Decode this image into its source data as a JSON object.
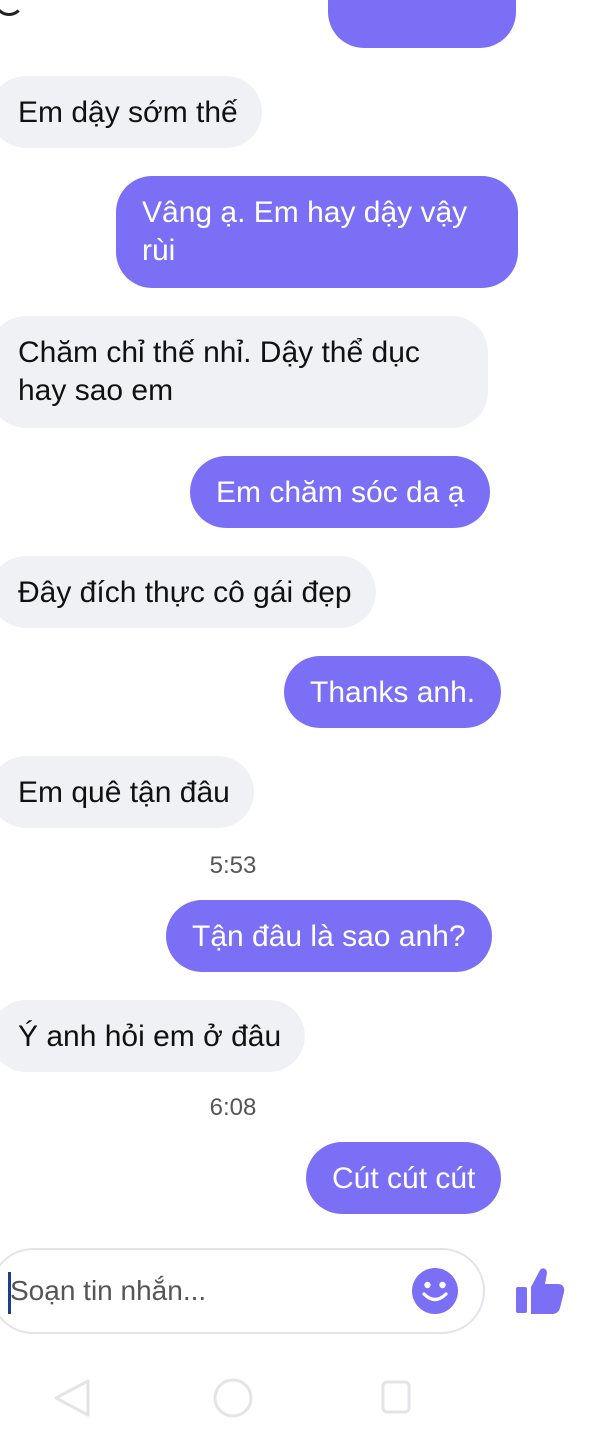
{
  "conversation": {
    "messages": [
      {
        "side": "in",
        "text": "Em dậy sớm thế"
      },
      {
        "side": "out",
        "text": "Vâng ạ. Em hay dậy vậy rùi"
      },
      {
        "side": "in",
        "text": "Chăm chỉ thế nhỉ. Dậy thể dục hay sao em"
      },
      {
        "side": "out",
        "text": "Em chăm sóc da ạ"
      },
      {
        "side": "in",
        "text": "Đây đích thực cô gái đẹp"
      },
      {
        "side": "out",
        "text": "Thanks anh."
      },
      {
        "side": "in",
        "text": "Em quê tận đâu"
      },
      {
        "side": "out",
        "text": "Tận đâu là sao anh?"
      },
      {
        "side": "in",
        "text": "Ý anh hỏi em ở đâu"
      },
      {
        "side": "out",
        "text": "Cút cút cút"
      }
    ],
    "timestamps": [
      "5:53",
      "6:08"
    ]
  },
  "composer": {
    "placeholder": "Soạn tin nhắn...",
    "value": "",
    "emoji_icon": "smiley-icon",
    "send_icon": "thumbs-up-icon"
  },
  "navigation": {
    "back_icon": "back-triangle-icon",
    "home_icon": "home-circle-icon",
    "recent_icon": "recent-apps-icon"
  },
  "colors": {
    "outgoing_bubble": "#7b6ff5",
    "incoming_bubble": "#f0f1f5",
    "accent": "#7b6ff5"
  }
}
